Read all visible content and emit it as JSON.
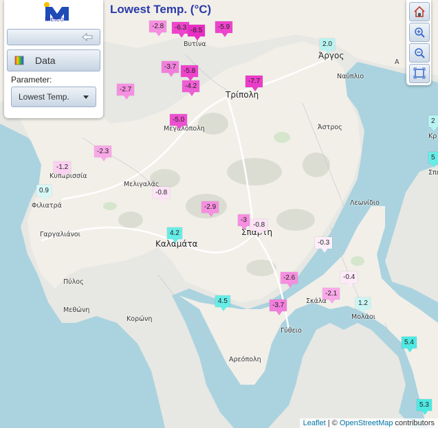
{
  "map_title": "Lowest Temp. (°C)",
  "logo": {
    "text": "Meteo"
  },
  "panel": {
    "data_label": "Data",
    "parameter_label": "Parameter:",
    "parameter_value": "Lowest Temp."
  },
  "tools": [
    "home-icon",
    "zoom-in-icon",
    "zoom-out-icon",
    "fit-extent-icon"
  ],
  "colors": {
    "very_cold": "#ee44cc",
    "cold": "#f58fdf",
    "cool": "#fbd0f0",
    "near_zero": "#fdeaf8",
    "mild": "#b8f3f1",
    "warm": "#67ece6",
    "title": "#2a3aa8"
  },
  "places": {
    "vytina": "Βυτίνα",
    "argos": "Άργος",
    "nafplio": "Ναύπλιο",
    "tripoli": "Τρίπολη",
    "astros": "Άστρος",
    "megalopoli": "Μεγαλόπολη",
    "kyparissia": "Κυπαρισσία",
    "filiatra": "Φιλιατρά",
    "meligalas": "Μελιγαλάς",
    "leonidio": "Λεωνίδιο",
    "gargaliani": "Γαργαλιάνοι",
    "kalamata": "Καλαμάτα",
    "sparti": "Σπάρτη",
    "pylos": "Πύλος",
    "skala": "Σκάλα",
    "methoni": "Μεθώνη",
    "koroni": "Κορώνη",
    "molaoi": "Μολάοι",
    "gytheio": "Γύθειο",
    "areopoli": "Αρεόπολη",
    "kranidi": "Κρ",
    "spetses": "Σπέ",
    "edge_a": "Α"
  },
  "markers": [
    {
      "value": "-2.8",
      "color": "#f58fdf"
    },
    {
      "value": "-6.3",
      "color": "#ee44cc"
    },
    {
      "value": "-8.5",
      "color": "#e82fc4"
    },
    {
      "value": "-5.9",
      "color": "#ee44cc"
    },
    {
      "value": "2.0",
      "color": "#b8f3f1"
    },
    {
      "value": "-3.7",
      "color": "#f07fdc"
    },
    {
      "value": "-5.8",
      "color": "#ee44cc"
    },
    {
      "value": "-4.2",
      "color": "#ee5fd4"
    },
    {
      "value": "-7.7",
      "color": "#ea3cc7"
    },
    {
      "value": "-2.7",
      "color": "#f58fdf"
    },
    {
      "value": "-5.0",
      "color": "#ee50d0"
    },
    {
      "value": "-2.3",
      "color": "#f8a9e7"
    },
    {
      "value": "-1.2",
      "color": "#fbd0f0"
    },
    {
      "value": "0.9",
      "color": "#d5f8f7"
    },
    {
      "value": "-0.8",
      "color": "#fde3f6"
    },
    {
      "value": "-2.9",
      "color": "#f58fdf"
    },
    {
      "value": "-3",
      "color": "#f58fdf"
    },
    {
      "value": "-0.8",
      "color": "#fde3f6"
    },
    {
      "value": "4.2",
      "color": "#67ece6"
    },
    {
      "value": "-0.3",
      "color": "#fdeff9"
    },
    {
      "value": "-0.4",
      "color": "#fdeaf8"
    },
    {
      "value": "-2.6",
      "color": "#f58fdf"
    },
    {
      "value": "-2.1",
      "color": "#f8a9e7"
    },
    {
      "value": "1.2",
      "color": "#c9f6f4"
    },
    {
      "value": "4.5",
      "color": "#67ece6"
    },
    {
      "value": "-3.7",
      "color": "#f07fdc"
    },
    {
      "value": "5.4",
      "color": "#4fe8e2"
    },
    {
      "value": "5.3",
      "color": "#4fe8e2"
    },
    {
      "value": "2",
      "color": "#b8f3f1"
    },
    {
      "value": "5",
      "color": "#67ece6"
    }
  ],
  "attribution": {
    "leaflet": "Leaflet",
    "sep": " | © ",
    "osm": "OpenStreetMap",
    "contrib": " contributors"
  }
}
